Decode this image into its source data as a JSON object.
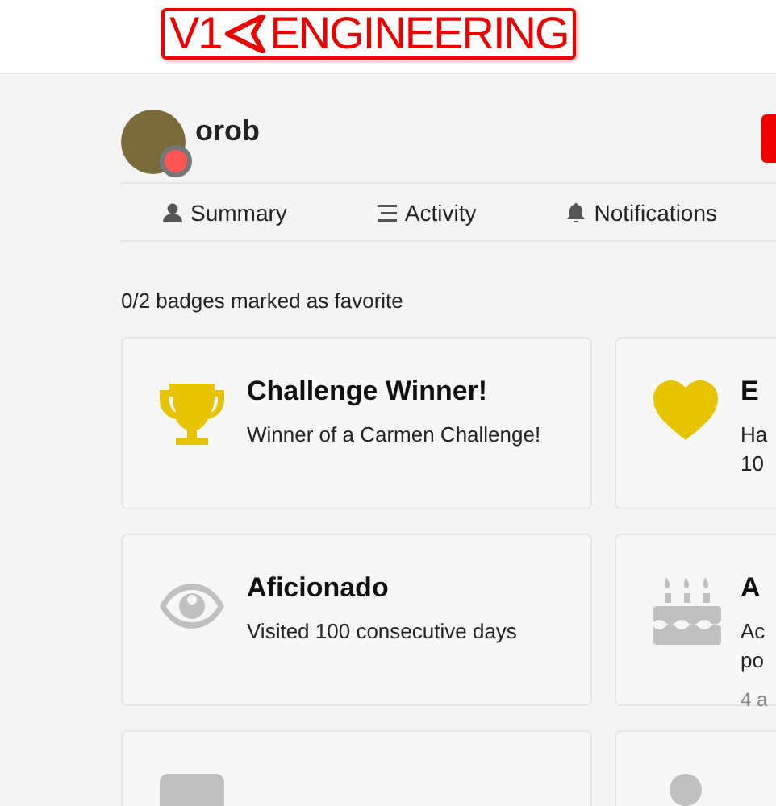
{
  "header": {
    "logo_left": "V1",
    "logo_right": "ENGINEERING"
  },
  "user": {
    "username": "orob"
  },
  "tabs": [
    {
      "label": "Summary"
    },
    {
      "label": "Activity"
    },
    {
      "label": "Notifications"
    }
  ],
  "favorites_note": "0/2 badges marked as favorite",
  "badges": [
    {
      "kind": "trophy",
      "color": "#e7c300",
      "title": "Challenge Winner!",
      "description": [
        "Winner of a Carmen Challenge!"
      ]
    },
    {
      "kind": "heart",
      "color": "#e7c300",
      "title": "E",
      "description": [
        "Ha",
        "10"
      ]
    },
    {
      "kind": "eye",
      "color": "#c0c0c0",
      "title": "Aficionado",
      "description": [
        "Visited 100 consecutive days"
      ]
    },
    {
      "kind": "cake",
      "color": "#c0c0c0",
      "title": "A",
      "description": [
        "Ac",
        "po"
      ],
      "granted": "4 a"
    },
    {
      "kind": "card",
      "color": "#c0c0c0"
    },
    {
      "kind": "person",
      "color": "#c0c0c0"
    }
  ]
}
